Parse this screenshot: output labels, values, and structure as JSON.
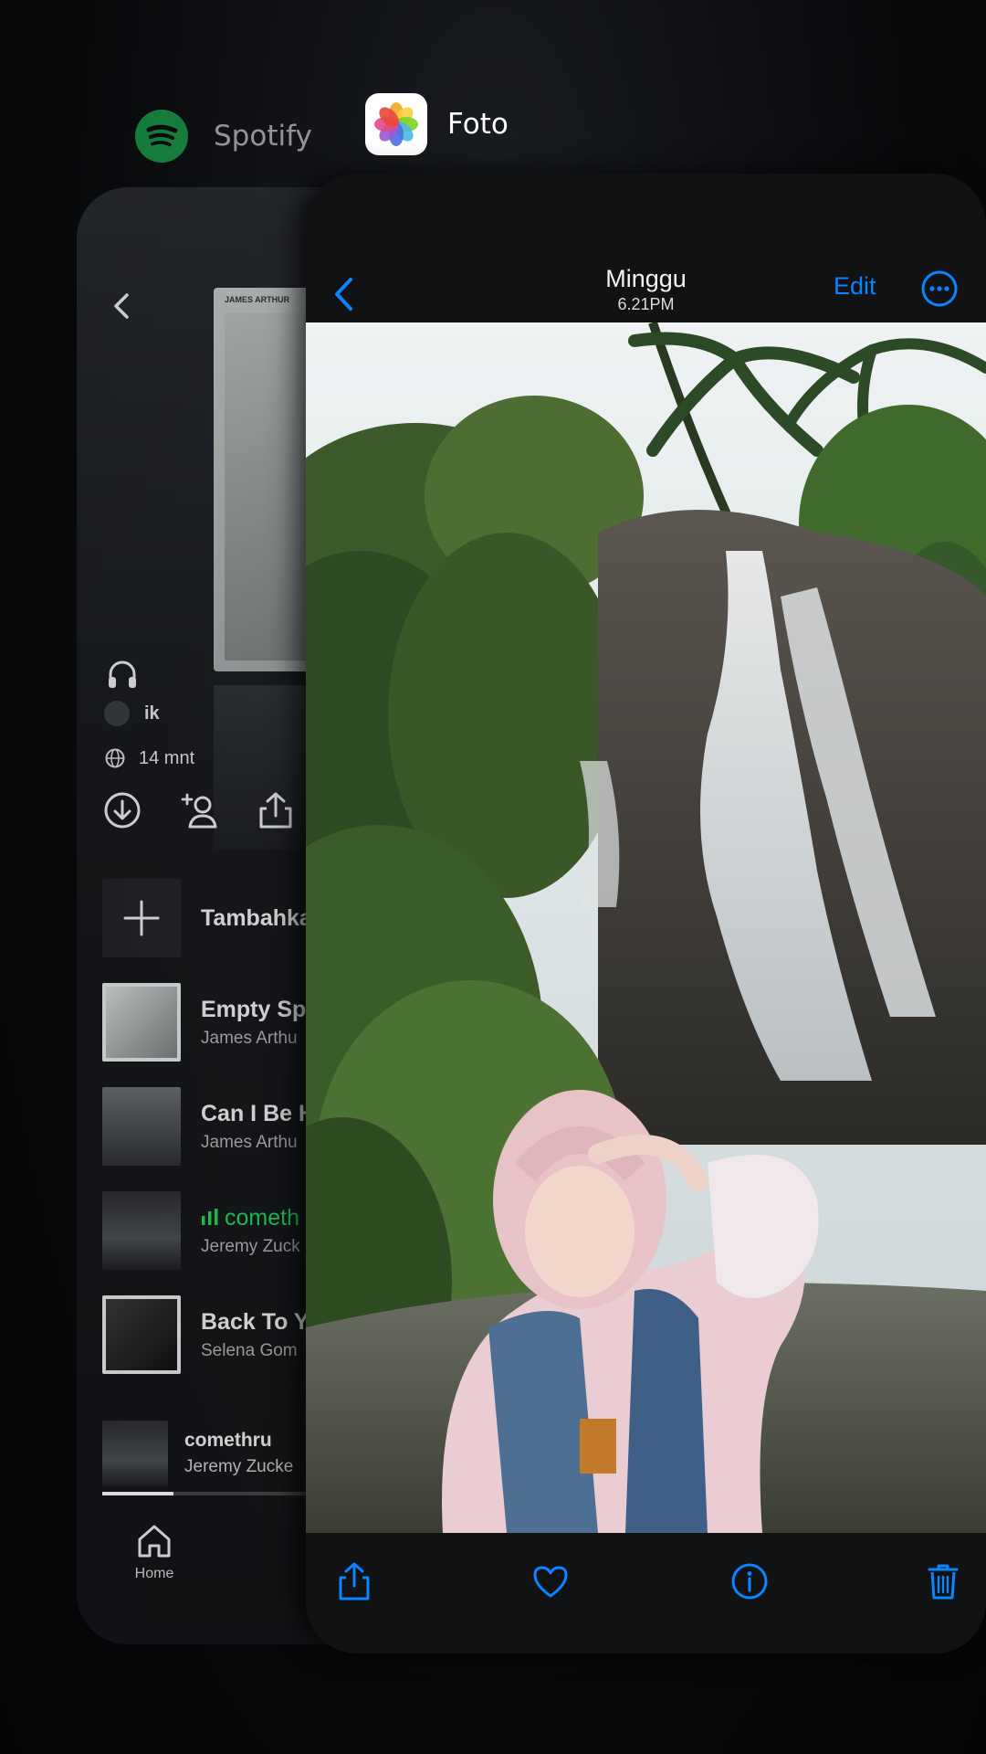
{
  "switcher": {
    "spotify_label": "Spotify",
    "foto_label": "Foto"
  },
  "spotify": {
    "cover_artist": "JAMES ARTHUR",
    "owner": "ik",
    "duration": "14 mnt",
    "add_label": "Tambahka",
    "tracks": [
      {
        "title": "Empty Spa",
        "artist": "James Arthu"
      },
      {
        "title": "Can I Be H",
        "artist": "James Arthu"
      },
      {
        "title": "cometh",
        "artist": "Jeremy Zuck"
      },
      {
        "title": "Back To Yo",
        "artist": "Selena Gom"
      }
    ],
    "now_playing": {
      "title": "comethru",
      "artist": "Jeremy Zucke"
    },
    "progress": 0.14,
    "home_label": "Home"
  },
  "foto": {
    "day": "Minggu",
    "time": "6.21PM",
    "edit_label": "Edit"
  },
  "colors": {
    "spotify_green": "#1ed760",
    "ios_blue": "#0a84ff"
  }
}
